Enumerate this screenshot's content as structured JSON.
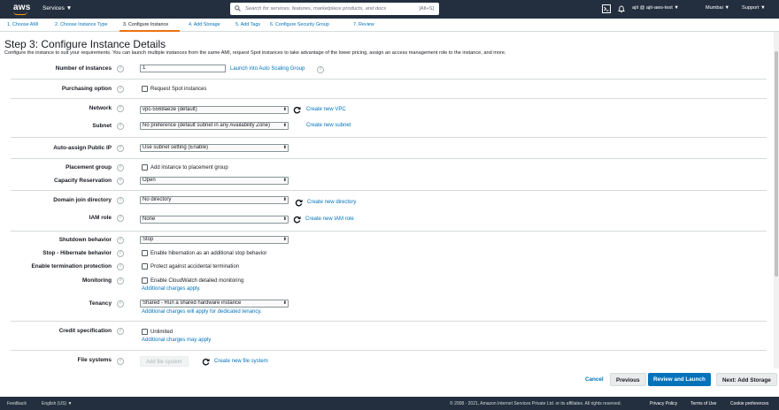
{
  "topnav": {
    "logo_text": "aws",
    "services_label": "Services ▼",
    "search_placeholder": "Search for services, features, marketplace products, and docs",
    "search_shortcut": "[Alt+S]",
    "account_label": "ajit @ ajit-aws-test ▼",
    "region_label": "Mumbai ▼",
    "support_label": "Support ▼",
    "icons": [
      "terminal-icon",
      "bell-icon"
    ],
    "bg_color": "#232f3e",
    "accent_color": "#ff9900"
  },
  "steps": [
    {
      "label": "1. Choose AMI",
      "active": false
    },
    {
      "label": "2. Choose Instance Type",
      "active": false
    },
    {
      "label": "3. Configure Instance",
      "active": true
    },
    {
      "label": "4. Add Storage",
      "active": false
    },
    {
      "label": "5. Add Tags",
      "active": false
    },
    {
      "label": "6. Configure Security Group",
      "active": false
    },
    {
      "label": "7. Review",
      "active": false
    }
  ],
  "page": {
    "title": "Step 3: Configure Instance Details",
    "description": "Configure the instance to suit your requirements. You can launch multiple instances from the same AMI, request Spot instances to take advantage of the lower pricing, assign an access management role to the instance, and more."
  },
  "form": {
    "number_of_instances": {
      "label": "Number of instances",
      "value": "1",
      "link": "Launch into Auto Scaling Group"
    },
    "purchasing_option": {
      "label": "Purchasing option",
      "checkbox": "Request Spot instances"
    },
    "network": {
      "label": "Network",
      "value": "vpc-5568ae3e (default)",
      "link": "Create new VPC"
    },
    "subnet": {
      "label": "Subnet",
      "value": "No preference (default subnet in any Availability Zone)",
      "link": "Create new subnet"
    },
    "public_ip": {
      "label": "Auto-assign Public IP",
      "value": "Use subnet setting (Enable)"
    },
    "placement_group": {
      "label": "Placement group",
      "checkbox": "Add instance to placement group"
    },
    "capacity_reservation": {
      "label": "Capacity Reservation",
      "value": "Open"
    },
    "domain_join": {
      "label": "Domain join directory",
      "value": "No directory",
      "link": "Create new directory"
    },
    "iam_role": {
      "label": "IAM role",
      "value": "None",
      "link": "Create new IAM role"
    },
    "shutdown_behavior": {
      "label": "Shutdown behavior",
      "value": "Stop"
    },
    "hibernate": {
      "label": "Stop - Hibernate behavior",
      "checkbox": "Enable hibernation as an additional stop behavior"
    },
    "termination_protection": {
      "label": "Enable termination protection",
      "checkbox": "Protect against accidental termination"
    },
    "monitoring": {
      "label": "Monitoring",
      "checkbox": "Enable CloudWatch detailed monitoring",
      "link": "Additional charges apply."
    },
    "tenancy": {
      "label": "Tenancy",
      "value": "Shared - Run a shared hardware instance",
      "link": "Additional charges will apply for dedicated tenancy."
    },
    "credit_specification": {
      "label": "Credit specification",
      "checkbox": "Unlimited",
      "link": "Additional charges may apply"
    },
    "file_systems": {
      "label": "File systems",
      "button": "Add file system",
      "link": "Create new file system"
    }
  },
  "actions": {
    "cancel": "Cancel",
    "previous": "Previous",
    "review_launch": "Review and Launch",
    "next": "Next: Add Storage",
    "primary_color": "#0073bb"
  },
  "footer": {
    "feedback": "Feedback",
    "language": "English (US) ▼",
    "copyright": "© 2008 - 2021, Amazon Internet Services Private Ltd. or its affiliates. All rights reserved.",
    "privacy": "Privacy Policy",
    "terms": "Terms of Use",
    "cookies": "Cookie preferences"
  }
}
